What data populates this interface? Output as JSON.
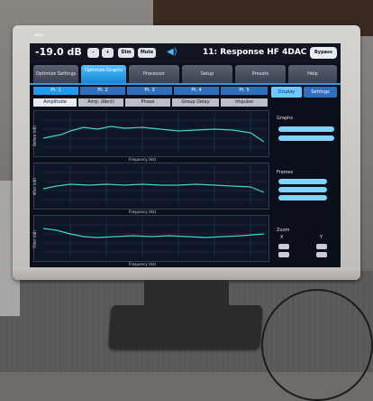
{
  "header": {
    "level": "-19.0 dB",
    "minus": "–",
    "plus": "+",
    "dim": "Dim",
    "mute": "Mute",
    "preset": "11: Response HF 4DAC",
    "bypass": "Bypass"
  },
  "tabs": [
    {
      "label": "Optimize Settings"
    },
    {
      "label": "Optimize Graphs"
    },
    {
      "label": "Processor"
    },
    {
      "label": "Setup"
    },
    {
      "label": "Presets"
    },
    {
      "label": "Help"
    }
  ],
  "active_tab_index": 1,
  "points": [
    "Pt. 1",
    "Pt. 2",
    "Pt. 3",
    "Pt. 4",
    "Pt. 5"
  ],
  "display_tabs": [
    "Display",
    "Settings"
  ],
  "graph_tabs": [
    "Amplitude",
    "Amp. (Rect)",
    "Phase",
    "Group Delay",
    "Impulse"
  ],
  "plots": [
    {
      "ylabel": "Before (dB)",
      "xlabel": "Frequency (Hz)"
    },
    {
      "ylabel": "After (dB)",
      "xlabel": "Frequency (Hz)"
    },
    {
      "ylabel": "Filter (dB)",
      "xlabel": "Frequency (Hz)"
    }
  ],
  "side": {
    "graphs_title": "Graphs",
    "frames_title": "Frames",
    "zoom_title": "Zoom",
    "x": "X",
    "y": "Y"
  },
  "colors": {
    "accent": "#2a9be8",
    "trace": "#3fd6c8",
    "screen_bg": "#0b0f1a"
  }
}
